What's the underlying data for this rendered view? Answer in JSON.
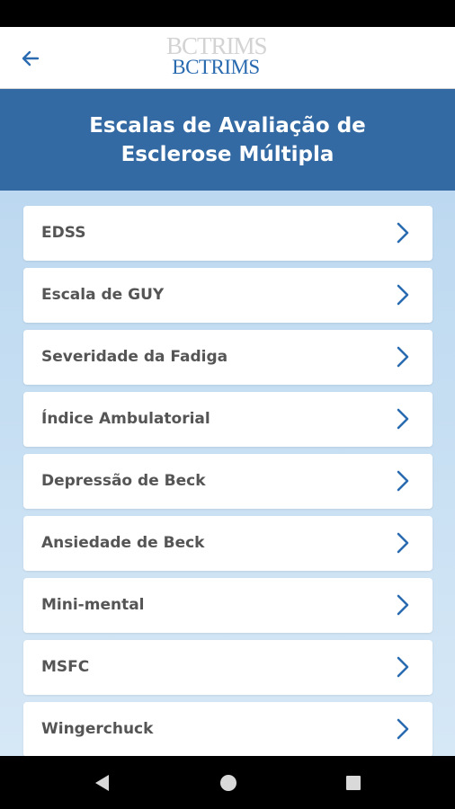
{
  "header": {
    "logo_ghost_text": "BCTRIMS",
    "logo_text": "BCTRIMS"
  },
  "title": "Escalas de Avaliação de\nEsclerose Múltipla",
  "items": [
    {
      "label": "EDSS"
    },
    {
      "label": "Escala de GUY"
    },
    {
      "label": "Severidade da Fadiga"
    },
    {
      "label": "Índice Ambulatorial"
    },
    {
      "label": "Depressão de Beck"
    },
    {
      "label": "Ansiedade de Beck"
    },
    {
      "label": "Mini-mental"
    },
    {
      "label": "MSFC"
    },
    {
      "label": "Wingerchuck"
    }
  ],
  "colors": {
    "accent": "#346aa3",
    "logo": "#2a6bb0",
    "chevron": "#2a6bb0"
  },
  "icons": {
    "back": "arrow-left-icon",
    "item": "chevron-right-icon",
    "nav_back": "triangle-back-icon",
    "nav_home": "circle-home-icon",
    "nav_recent": "square-recent-icon"
  }
}
